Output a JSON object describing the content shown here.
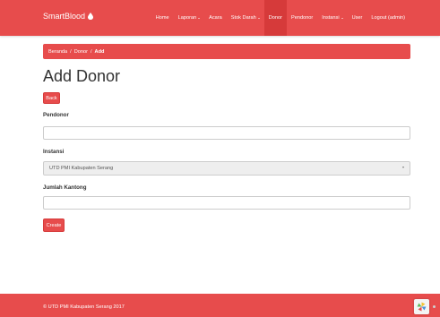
{
  "navbar": {
    "brand": "SmartBlood",
    "brand_icon": "blood-drop-icon",
    "items": [
      {
        "label": "Home",
        "dropdown": false
      },
      {
        "label": "Laporan",
        "dropdown": true
      },
      {
        "label": "Acara",
        "dropdown": false
      },
      {
        "label": "Stok Darah",
        "dropdown": true
      },
      {
        "label": "Donor",
        "dropdown": false,
        "active": true
      },
      {
        "label": "Pendonor",
        "dropdown": false
      },
      {
        "label": "Instansi",
        "dropdown": true
      },
      {
        "label": "User",
        "dropdown": false
      },
      {
        "label": "Logout (admin)",
        "dropdown": false
      }
    ]
  },
  "breadcrumb": {
    "items": [
      "Beranda",
      "Donor",
      "Add"
    ],
    "separator": "/"
  },
  "page": {
    "title": "Add Donor",
    "back_label": "Back"
  },
  "form": {
    "pendonor": {
      "label": "Pendonor",
      "value": ""
    },
    "instansi": {
      "label": "Instansi",
      "selected": "UTD PMI Kabupaten Serang"
    },
    "jumlah_kantong": {
      "label": "Jumlah Kantong",
      "value": ""
    },
    "submit_label": "Create"
  },
  "footer": {
    "text": "© UTD PMI Kabupaten Serang 2017"
  },
  "colors": {
    "accent": "#e74c4c",
    "accent_dark": "#d63a3a",
    "text": "#333333",
    "select_bg": "#eeeeee"
  }
}
